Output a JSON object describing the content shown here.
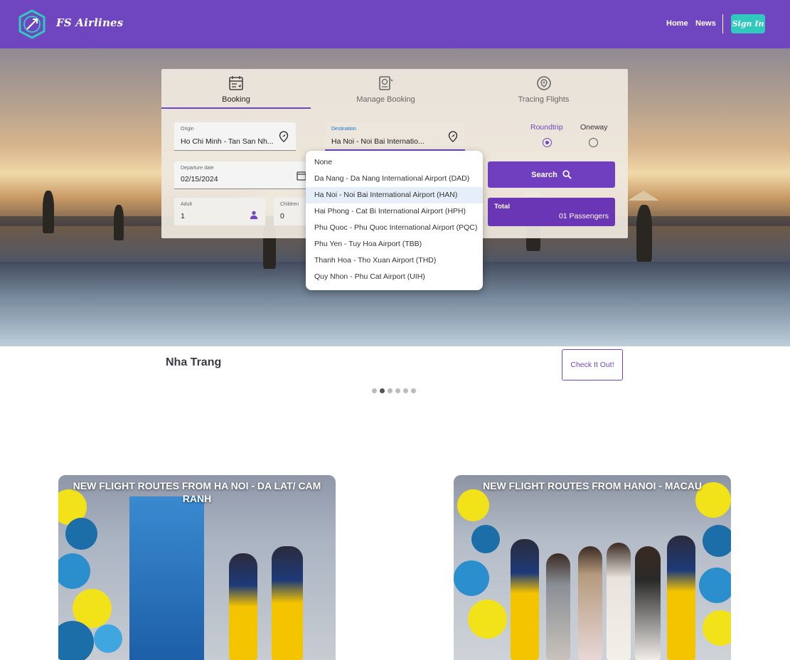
{
  "header": {
    "brand": "FS Airlines",
    "nav": [
      "Home",
      "News"
    ],
    "signin_label": "Sign In",
    "colors": {
      "bar": "#6f46c0",
      "signin": "#2fc9bd"
    }
  },
  "booking": {
    "tabs": [
      {
        "label": "Booking",
        "icon": "calendar-ticket-icon",
        "active": true
      },
      {
        "label": "Manage Booking",
        "icon": "passport-icon",
        "active": false
      },
      {
        "label": "Tracing Flights",
        "icon": "location-target-icon",
        "active": false
      }
    ],
    "origin": {
      "label": "Origin",
      "value": "Ho Chi Minh - Tan San Nh..."
    },
    "destination": {
      "label": "Destination",
      "value": "Ha Noi - Noi Bai Internatio..."
    },
    "trip_type": {
      "options": [
        "Roundtrip",
        "Oneway"
      ],
      "selected": "Roundtrip"
    },
    "departure": {
      "label": "Departure date",
      "value": "02/15/2024"
    },
    "adult": {
      "label": "Adult",
      "value": "1"
    },
    "children": {
      "label": "Children",
      "value": "0"
    },
    "search_label": "Search",
    "total": {
      "label": "Total",
      "value": "01 Passengers"
    }
  },
  "destination_dropdown": {
    "options": [
      "None",
      "Da Nang - Da Nang International Airport (DAD)",
      "Ha Noi - Noi Bai International Airport (HAN)",
      "Hai Phong - Cat Bi International Airport (HPH)",
      "Phu Quoc - Phu Quoc International Airport (PQC)",
      "Phu Yen - Tuy Hoa Airport (TBB)",
      "Thanh Hoa - Tho Xuan Airport (THD)",
      "Quy Nhon - Phu Cat Airport (UIH)"
    ],
    "selected_index": 2
  },
  "carousel": {
    "city": "Nha Trang",
    "cta_label": "Check It Out!",
    "slides": 6,
    "active_index": 1
  },
  "news": [
    {
      "title": "NEW FLIGHT ROUTES FROM HA NOI - DA LAT/ CAM RANH"
    },
    {
      "title": "NEW FLIGHT ROUTES FROM HANOI - MACAU"
    }
  ]
}
